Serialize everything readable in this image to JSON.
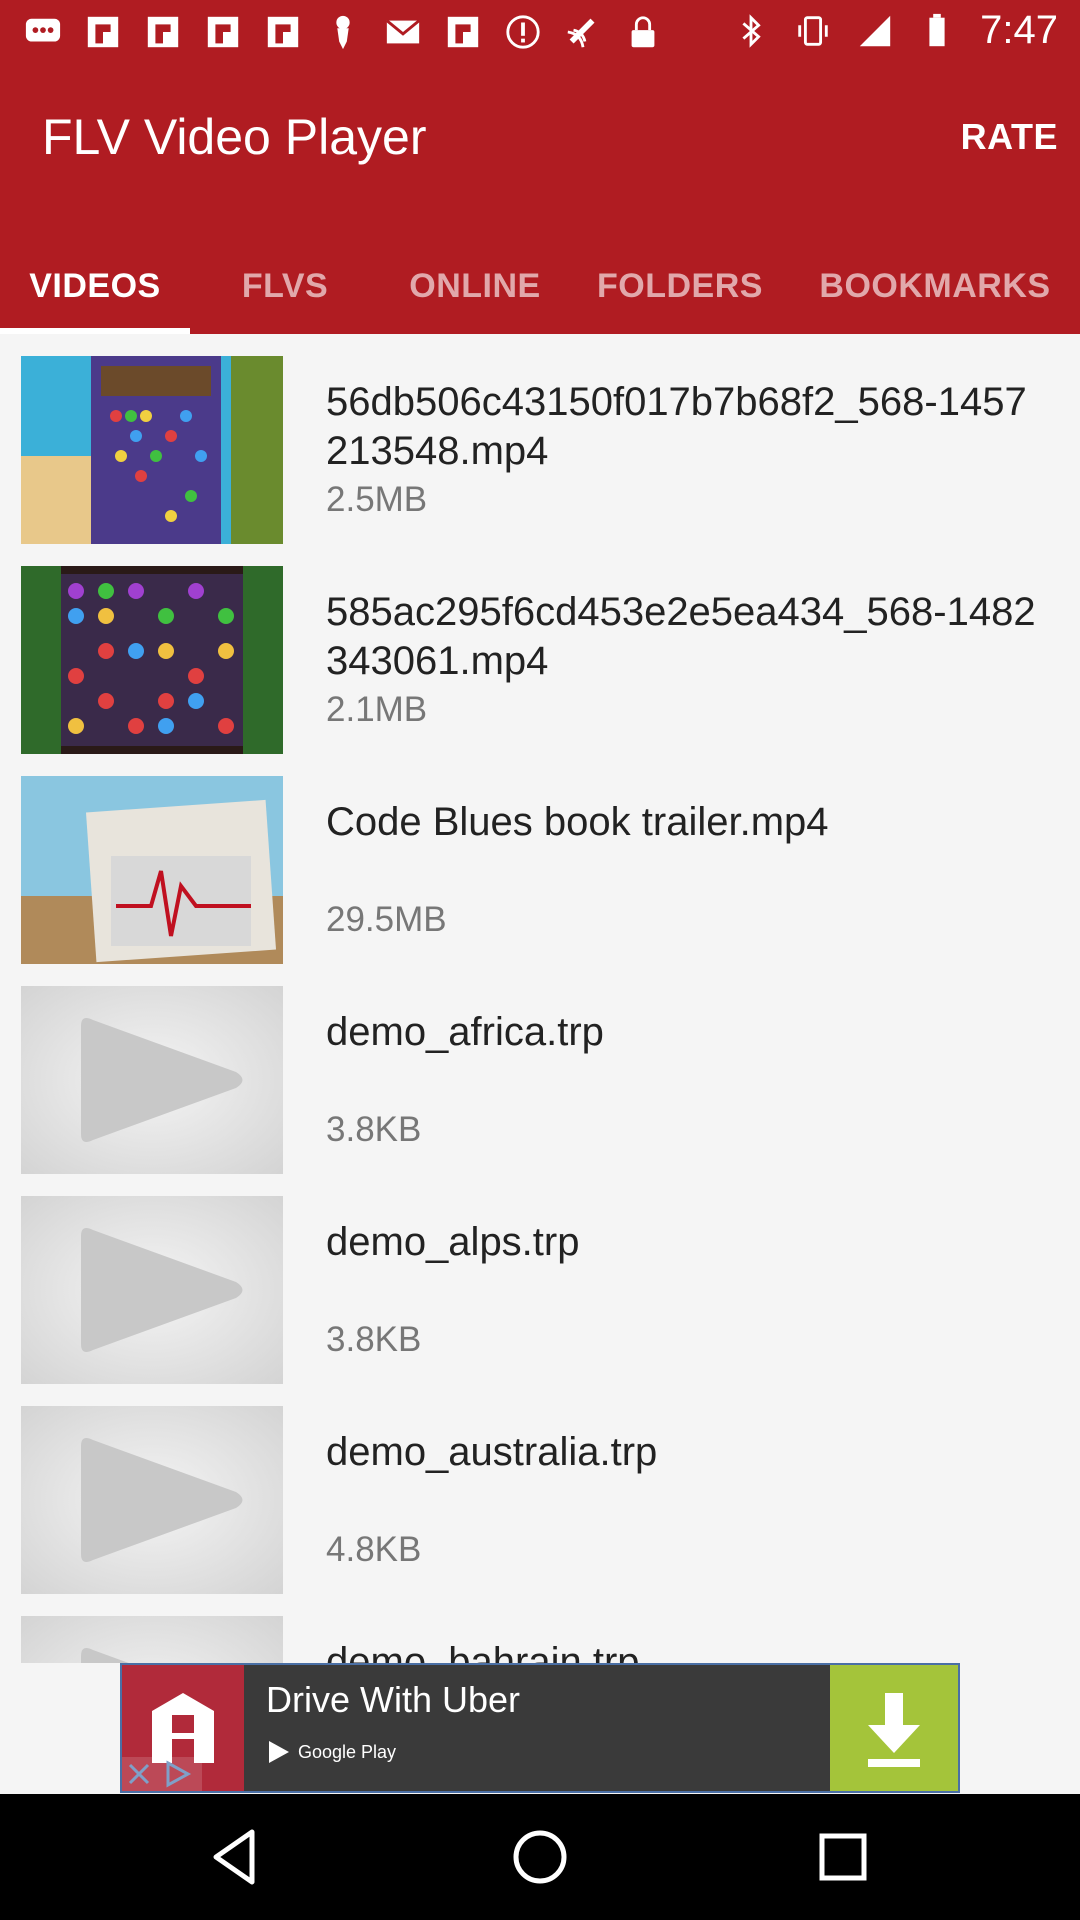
{
  "status_bar": {
    "time": "7:47",
    "left_icons": [
      "messages-icon",
      "flipboard-icon",
      "flipboard-icon",
      "flipboard-icon",
      "flipboard-icon",
      "pin-icon",
      "mail-icon",
      "flipboard-icon",
      "alert-icon",
      "fake-gps-icon",
      "lock-icon"
    ],
    "right_icons": [
      "bluetooth-icon",
      "vibrate-icon",
      "signal-icon",
      "battery-icon"
    ]
  },
  "app_bar": {
    "title": "FLV Video Player",
    "rate_label": "RATE"
  },
  "tabs": [
    {
      "label": "VIDEOS",
      "active": true
    },
    {
      "label": "FLVS",
      "active": false
    },
    {
      "label": "ONLINE",
      "active": false
    },
    {
      "label": "FOLDERS",
      "active": false
    },
    {
      "label": "BOOKMARKS",
      "active": false
    }
  ],
  "videos": [
    {
      "name": "56db506c43150f017b7b68f2_568-1457213548.mp4",
      "size": "2.5MB",
      "thumb": "game-gems-island"
    },
    {
      "name": "585ac295f6cd453e2e5ea434_568-1482343061.mp4",
      "size": "2.1MB",
      "thumb": "game-gems-grid"
    },
    {
      "name": "Code Blues book trailer.mp4",
      "size": "29.5MB",
      "thumb": "heartbeat-photo"
    },
    {
      "name": "demo_africa.trp",
      "size": "3.8KB",
      "thumb": "placeholder"
    },
    {
      "name": "demo_alps.trp",
      "size": "3.8KB",
      "thumb": "placeholder"
    },
    {
      "name": "demo_australia.trp",
      "size": "4.8KB",
      "thumb": "placeholder"
    },
    {
      "name": "demo_bahrain.trp",
      "size": "",
      "thumb": "placeholder"
    }
  ],
  "ad": {
    "title": "Drive With Uber",
    "store": "Google Play",
    "colors": {
      "logo_bg": "#b12a3a",
      "download_bg": "#a4c43a"
    }
  },
  "colors": {
    "primary": "#b01c22",
    "background": "#f5f5f5"
  }
}
